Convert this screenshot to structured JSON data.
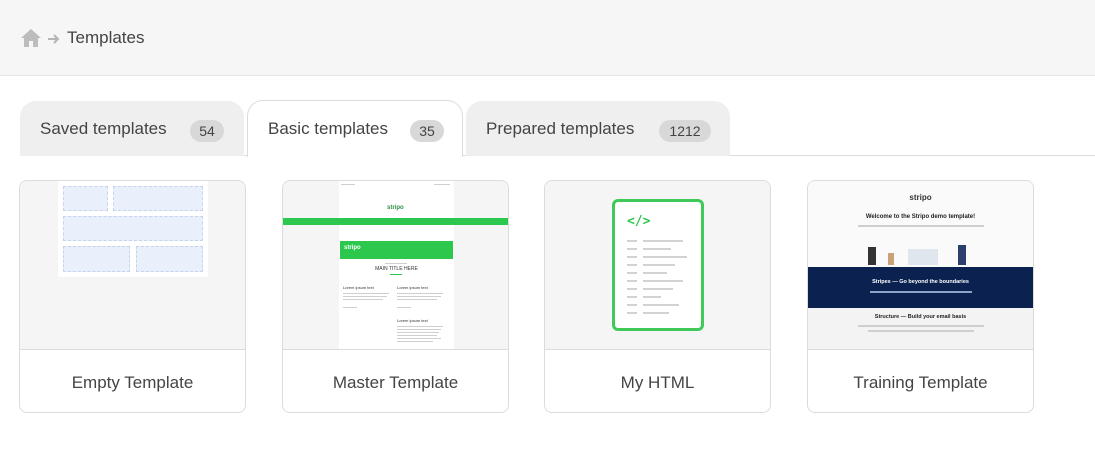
{
  "breadcrumb": {
    "home_icon": "home-icon",
    "separator_icon": "arrow-right-icon",
    "current": "Templates"
  },
  "tabs": [
    {
      "label": "Saved templates",
      "count": "54",
      "active": false
    },
    {
      "label": "Basic templates",
      "count": "35",
      "active": true
    },
    {
      "label": "Prepared templates",
      "count": "1212",
      "active": false
    }
  ],
  "templates": [
    {
      "title": "Empty Template"
    },
    {
      "title": "Master Template",
      "preview": {
        "brand": "stripo",
        "heading": "MAIN TITLE HERE",
        "col1_title": "Lorem ipsum text",
        "col2_title": "Lorem ipsum text",
        "col3_title": "Lorem ipsum text"
      }
    },
    {
      "title": "My HTML",
      "preview": {
        "code_glyph": "</>"
      }
    },
    {
      "title": "Training Template",
      "preview": {
        "brand": "stripo",
        "welcome": "Welcome to the Stripo demo template!",
        "band_title": "Stripes — Go beyond the boundaries",
        "structure_title": "Structure — Build your email basis"
      }
    }
  ],
  "colors": {
    "header_bg": "#f6f6f6",
    "accent_green": "#2cc84d",
    "navy": "#0b2250",
    "badge_bg": "#d8d8d8",
    "border": "#dcdcdc"
  }
}
